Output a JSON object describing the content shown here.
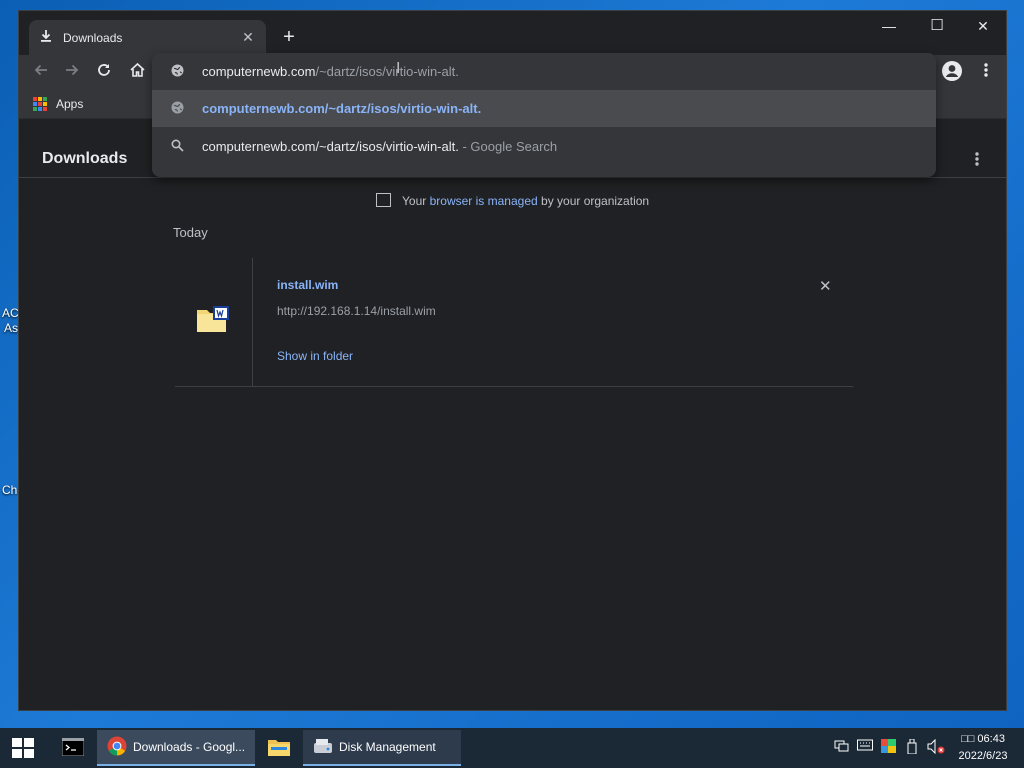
{
  "desktop": {
    "fragment_1": "AC",
    "fragment_2": "As",
    "fragment_3": "Ch"
  },
  "browser": {
    "tab": {
      "title": "Downloads",
      "icon": "download-icon"
    },
    "window_controls": {
      "minimize": "—",
      "maximize": "☐",
      "close": "✕"
    },
    "omnibox": {
      "typed": "computernewb.com",
      "autocomplete_rest": "/~dartz/isos/virtio-win-alt.",
      "suggestions": [
        {
          "icon": "globe-icon",
          "text": "computernewb.com/~dartz/isos/virtio-win-alt.",
          "suffix": ""
        },
        {
          "icon": "search-icon",
          "text": "computernewb.com/~dartz/isos/virtio-win-alt.",
          "suffix": "Google Search"
        }
      ]
    },
    "bookmarks": {
      "apps_label": "Apps"
    }
  },
  "downloads": {
    "title": "Downloads",
    "managed_prefix": "Your",
    "managed_link": "browser is managed",
    "managed_suffix": "by your organization",
    "section": "Today",
    "items": [
      {
        "filename": "install.wim",
        "url": "http://192.168.1.14/install.wim",
        "action": "Show in folder"
      }
    ]
  },
  "taskbar": {
    "items": [
      {
        "label": "",
        "icon": "terminal-icon"
      },
      {
        "label": "Downloads - Googl...",
        "icon": "chrome-icon"
      },
      {
        "label": "",
        "icon": "file-explorer-icon"
      },
      {
        "label": "Disk Management",
        "icon": "disk-management-icon"
      }
    ],
    "clock_time": "□□ 06:43",
    "clock_date": "2022/6/23"
  },
  "colors": {
    "accent_link": "#8ab4f8",
    "window_bg": "#202124",
    "toolbar_bg": "#35363a"
  }
}
